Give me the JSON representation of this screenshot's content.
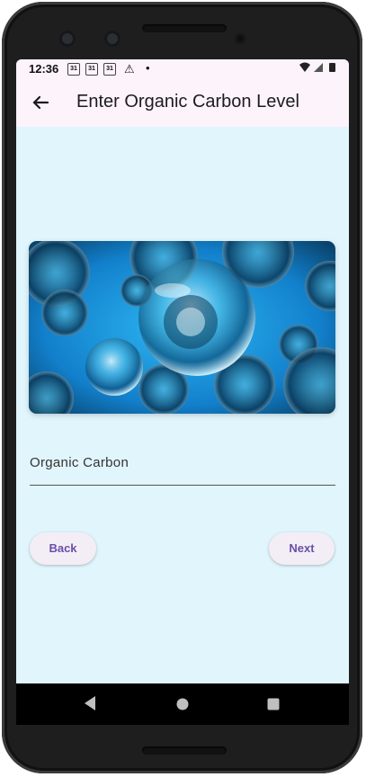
{
  "status_bar": {
    "time": "12:36",
    "calendar_icons": [
      "31",
      "31",
      "31"
    ],
    "alert_icon": "warning-icon",
    "notification_dot": "•",
    "system_icons": [
      "wifi-icon",
      "signal-icon",
      "battery-icon"
    ]
  },
  "app_bar": {
    "back_icon": "arrow-left-icon",
    "title": "Enter Organic Carbon Level"
  },
  "hero_image": {
    "subject": "microscopic cells / bubbles on blue background",
    "accent_color": "#1e9ee0"
  },
  "form": {
    "field_label": "Organic Carbon",
    "field_value": ""
  },
  "buttons": {
    "back_label": "Back",
    "next_label": "Next"
  },
  "navigation": {
    "back_icon": "triangle-back-icon",
    "home_icon": "circle-home-icon",
    "recents_icon": "square-recents-icon"
  },
  "colors": {
    "screen_background": "#e1f5fd",
    "app_bar_background": "#fdf3fb",
    "button_text": "#6a4fa8"
  }
}
